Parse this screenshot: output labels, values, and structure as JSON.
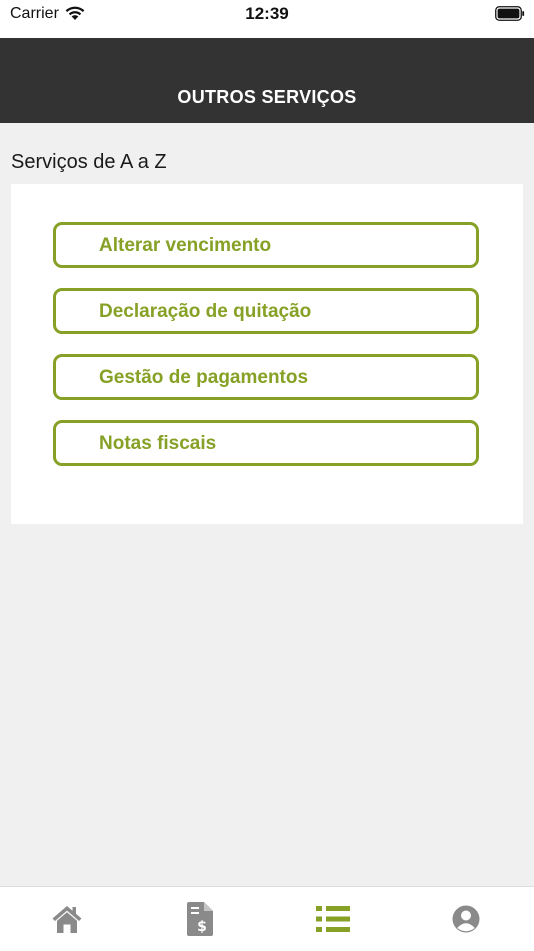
{
  "status_bar": {
    "carrier": "Carrier",
    "time": "12:39"
  },
  "header": {
    "title": "OUTROS SERVIÇOS"
  },
  "section": {
    "title": "Serviços de A a Z",
    "items": [
      {
        "label": "Alterar vencimento"
      },
      {
        "label": "Declaração de quitação"
      },
      {
        "label": "Gestão de pagamentos"
      },
      {
        "label": "Notas fiscais"
      }
    ]
  },
  "tab_bar": {
    "tabs": [
      {
        "icon": "home-icon",
        "active": false
      },
      {
        "icon": "invoice-dollar-icon",
        "active": false
      },
      {
        "icon": "list-icon",
        "active": true
      },
      {
        "icon": "user-profile-icon",
        "active": false
      }
    ]
  },
  "colors": {
    "accent": "#86a125",
    "header_bg": "#333333",
    "page_bg": "#f0f0f0",
    "tab_inactive": "#8a8a8a"
  }
}
